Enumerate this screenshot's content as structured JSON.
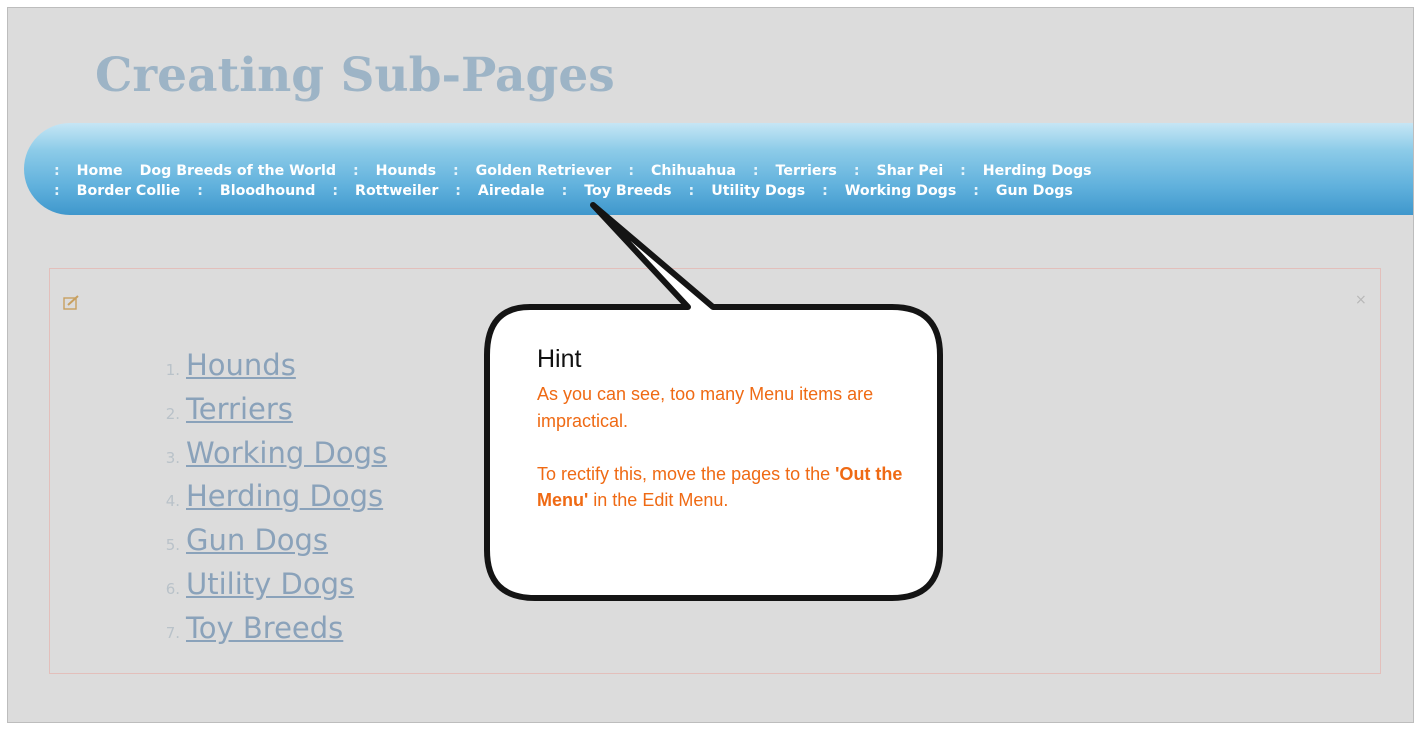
{
  "page_title": "Creating Sub-Pages",
  "nav": {
    "row1": [
      "Home",
      "Dog Breeds of the World",
      "Hounds",
      "Golden Retriever",
      "Chihuahua",
      "Terriers",
      "Shar Pei",
      "Herding Dogs"
    ],
    "row2": [
      "Border Collie",
      "Bloodhound",
      "Rottweiler",
      "Airedale",
      "Toy Breeds",
      "Utility Dogs",
      "Working Dogs",
      "Gun Dogs"
    ],
    "separator": ":"
  },
  "list": {
    "items": [
      {
        "num": "1.",
        "label": "Hounds"
      },
      {
        "num": "2.",
        "label": "Terriers"
      },
      {
        "num": "3.",
        "label": "Working Dogs"
      },
      {
        "num": "4.",
        "label": "Herding Dogs"
      },
      {
        "num": "5.",
        "label": "Gun Dogs"
      },
      {
        "num": "6.",
        "label": "Utility Dogs"
      },
      {
        "num": "7.",
        "label": "Toy Breeds"
      }
    ]
  },
  "panel": {
    "close_label": "×",
    "edit_icon": "edit-icon"
  },
  "hint": {
    "title": "Hint",
    "line1": "As you can see, too many Menu items are impractical.",
    "line2_pre": "To rectify this, move the pages to the ",
    "line2_bold": "'Out the Menu'",
    "line2_post": " in the Edit Menu."
  },
  "colors": {
    "nav_top": "#c6e6f5",
    "nav_bottom": "#3f97cc",
    "hint_text": "#ef6a14",
    "title": "#9db4c6"
  }
}
